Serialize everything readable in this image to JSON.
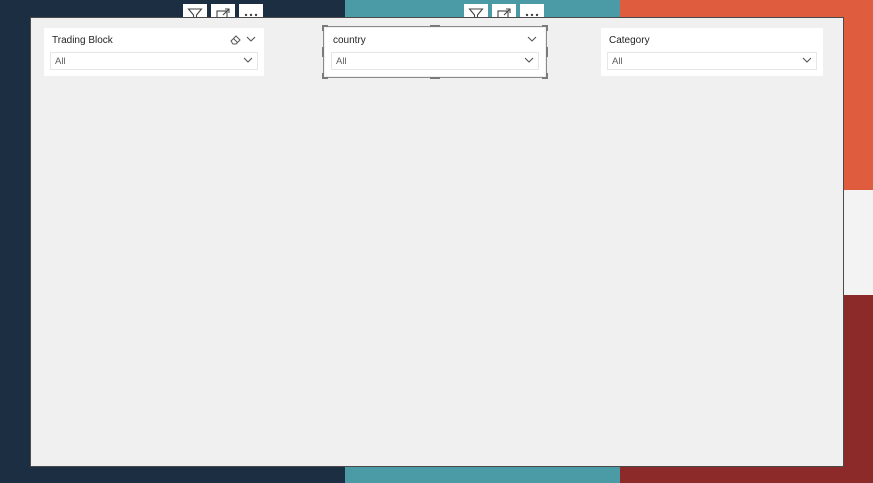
{
  "slicers": {
    "trading_block": {
      "title": "Trading Block",
      "value": "All",
      "icons": [
        "eraser-icon",
        "chevron-down-icon"
      ]
    },
    "country": {
      "title": "country",
      "value": "All",
      "selected": true
    },
    "category": {
      "title": "Category",
      "value": "All"
    }
  },
  "visual_toolbar": {
    "icons": [
      "filter-icon",
      "focus-mode-icon",
      "more-options-icon"
    ]
  },
  "colors": {
    "navy": "#1b2e42",
    "teal": "#4a9ba6",
    "orange": "#e05c3e",
    "dark_red": "#8c2a2a",
    "canvas": "#f0f0f0"
  }
}
